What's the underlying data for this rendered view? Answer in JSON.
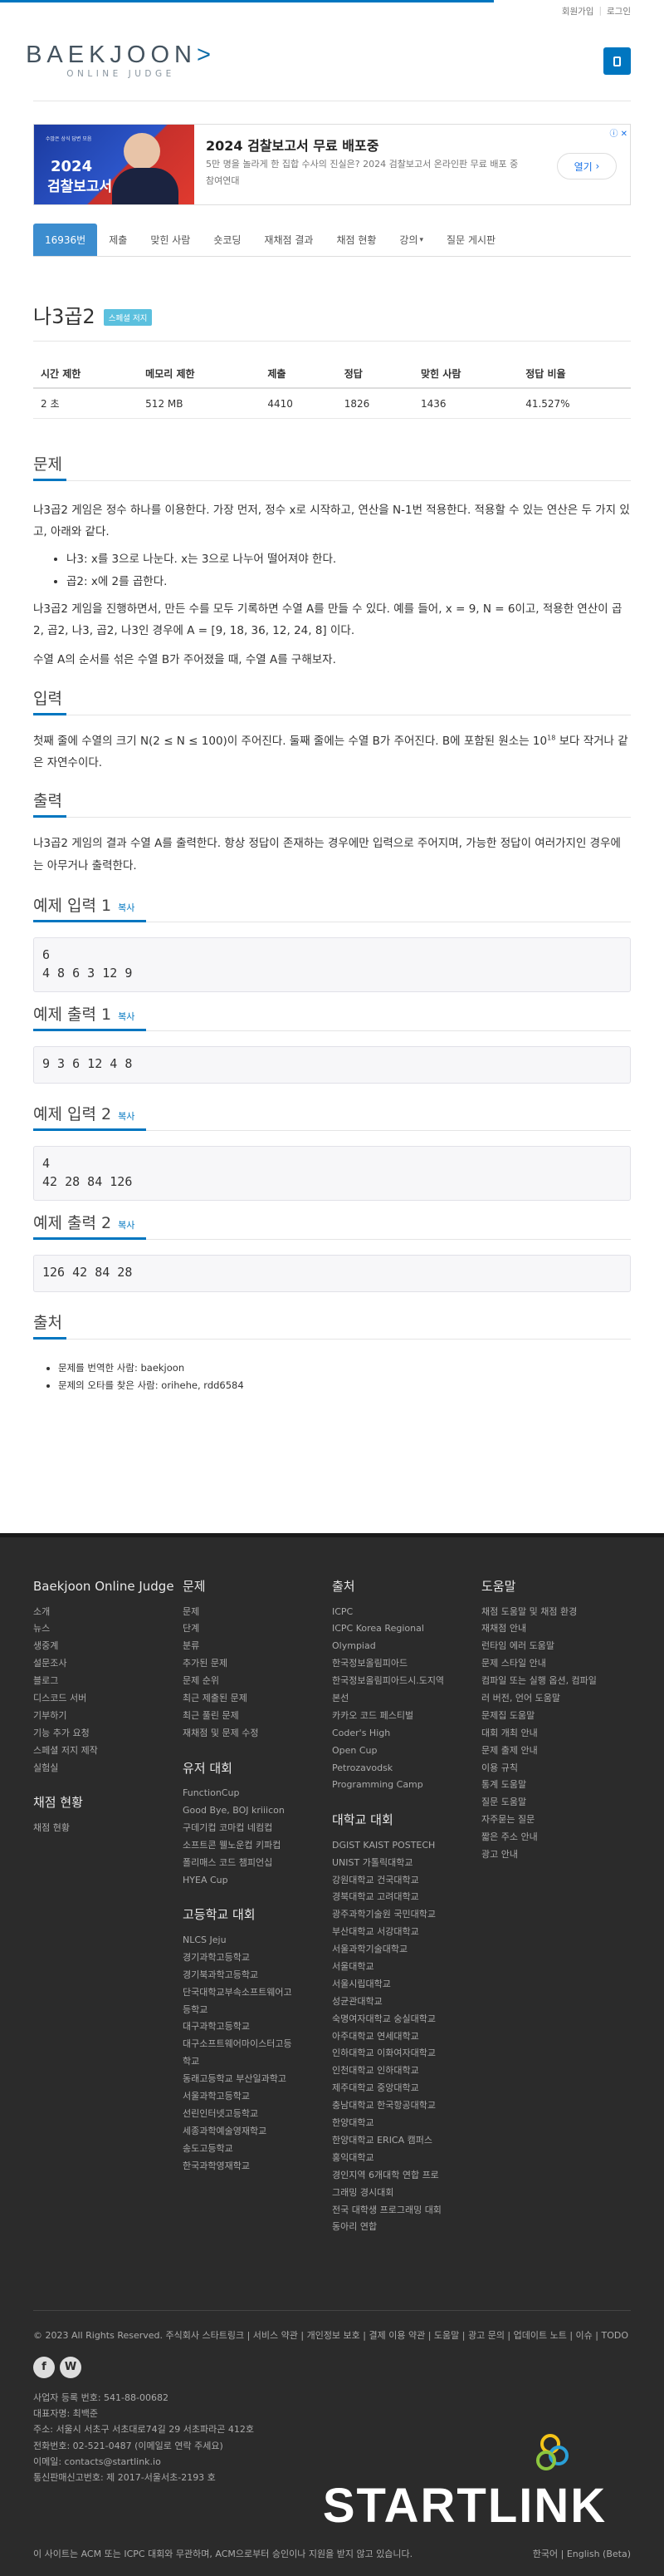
{
  "topbar": {
    "signup": "회원가입",
    "login": "로그인"
  },
  "logo": {
    "main_left": "BAEKJOON",
    "main_right": ">",
    "sub": "ONLINE JUDGE"
  },
  "ad": {
    "image_text_small": "수많은 상식 답변 모음",
    "image_text_year": "2024",
    "image_text_main": "검찰보고서",
    "title": "2024 검찰보고서 무료 배포중",
    "desc": "5만 명을 놀라게 한 집합 수사의 진실은? 2024 검찰보고서 온라인판 무료 배포 중",
    "source": "참여연대",
    "button": "열기",
    "close": "ⓘ ✕"
  },
  "tabs": [
    {
      "label": "16936번",
      "active": true
    },
    {
      "label": "제출"
    },
    {
      "label": "맞힌 사람"
    },
    {
      "label": "숏코딩"
    },
    {
      "label": "재채점 결과"
    },
    {
      "label": "채점 현황"
    },
    {
      "label": "강의",
      "dropdown": true
    },
    {
      "label": "질문 게시판"
    }
  ],
  "problem": {
    "title": "나3곱2",
    "badge": "스페셜 저지",
    "table_headers": [
      "시간 제한",
      "메모리 제한",
      "제출",
      "정답",
      "맞힌 사람",
      "정답 비율"
    ],
    "table_values": [
      "2 초",
      "512 MB",
      "4410",
      "1826",
      "1436",
      "41.527%"
    ]
  },
  "sections": {
    "problem_h": "문제",
    "problem_p1": "나3곱2 게임은 정수 하나를 이용한다. 가장 먼저, 정수 x로 시작하고, 연산을 N-1번 적용한다. 적용할 수 있는 연산은 두 가지 있고, 아래와 같다.",
    "bullet1": "나3: x를 3으로 나눈다. x는 3으로 나누어 떨어져야 한다.",
    "bullet2": "곱2: x에 2를 곱한다.",
    "problem_p2": "나3곱2 게임을 진행하면서, 만든 수를 모두 기록하면 수열 A를 만들 수 있다. 예를 들어, x = 9, N = 6이고, 적용한 연산이 곱2, 곱2, 나3, 곱2, 나3인 경우에 A = [9, 18, 36, 12, 24, 8] 이다.",
    "problem_p3": "수열 A의 순서를 섞은 수열 B가 주어졌을 때, 수열 A를 구해보자.",
    "input_h": "입력",
    "input_p_a": "첫째 줄에 수열의 크기 N(2 ≤ N ≤ 100)이 주어진다. 둘째 줄에는 수열 B가 주어진다. B에 포함된 원소는 10",
    "input_p_sup": "18",
    "input_p_b": " 보다 작거나 같은 자연수이다.",
    "output_h": "출력",
    "output_p": "나3곱2 게임의 결과 수열 A를 출력한다. 항상 정답이 존재하는 경우에만 입력으로 주어지며, 가능한 정답이 여러가지인 경우에는 아무거나 출력한다.",
    "copy": "복사",
    "sample_in1_h": "예제 입력 1",
    "sample_in1": "6\n4 8 6 3 12 9",
    "sample_out1_h": "예제 출력 1",
    "sample_out1": "9 3 6 12 4 8",
    "sample_in2_h": "예제 입력 2",
    "sample_in2": "4\n42 28 84 126",
    "sample_out2_h": "예제 출력 2",
    "sample_out2": "126 42 84 28",
    "source_h": "출처",
    "source_1": "문제를 번역한 사람: baekjoon",
    "source_2": "문제의 오타를 찾은 사람: orihehe, rdd6584"
  },
  "footer": {
    "col1_h": "Baekjoon Online Judge",
    "col1": [
      "소개",
      "뉴스",
      "생중계",
      "설문조사",
      "블로그",
      "디스코드 서버",
      "기부하기",
      "기능 추가 요청",
      "스페셜 저지 제작",
      "실험실"
    ],
    "col1b_h": "채점 현황",
    "col1b": [
      "채점 현황"
    ],
    "col2_h": "문제",
    "col2": [
      "문제",
      "단계",
      "분류",
      "추가된 문제",
      "문제 순위",
      "최근 제출된 문제",
      "최근 풀린 문제",
      "재채점 및 문제 수정"
    ],
    "col2b_h": "유저 대회",
    "col2b": [
      "FunctionCup",
      "Good Bye, BOJ kriiicon",
      "구데기컵 코마컵 네컴컵",
      "소프트콘 웰노운컵 키파컵",
      "폴리매스 코드 챔피언십",
      "HYEA Cup"
    ],
    "col2c_h": "고등학교 대회",
    "col2c": [
      "NLCS Jeju",
      "경기과학고등학교",
      "경기북과학고등학교",
      "단국대학교부속소프트웨어고",
      "등학교",
      "대구과학고등학교",
      "대구소프트웨어마이스터고등",
      "학교",
      "동래고등학교 부산일과학고",
      "서울과학고등학교",
      "선린인터넷고등학교",
      "세종과학예술영재학교",
      "송도고등학교",
      "한국과학영재학교"
    ],
    "col3_h": "출처",
    "col3": [
      "ICPC",
      "ICPC Korea Regional",
      "Olympiad",
      "한국정보올림피아드",
      "한국정보올림피아드시.도지역",
      "본선",
      "카카오 코드 페스티벌",
      "Coder's High",
      "Open Cup",
      "Petrozavodsk",
      "Programming Camp"
    ],
    "col3b_h": "대학교 대회",
    "col3b": [
      "DGIST KAIST POSTECH",
      "UNIST 가톨릭대학교",
      "강원대학교 건국대학교",
      "경북대학교 고려대학교",
      "광주과학기술원 국민대학교",
      "부산대학교 서강대학교",
      "서울과학기술대학교",
      "서울대학교",
      "서울시립대학교",
      "성균관대학교",
      "숙명여자대학교 숭실대학교",
      "아주대학교 연세대학교",
      "인하대학교 이화여자대학교",
      "인천대학교 인하대학교",
      "제주대학교 중앙대학교",
      "충남대학교 한국항공대학교",
      "한양대학교",
      "한양대학교 ERICA 캠퍼스",
      "홍익대학교",
      "경인지역 6개대학 연합 프로",
      "그래밍 경시대회",
      "전국 대학생 프로그래밍 대회",
      "동아리 연합"
    ],
    "col4_h": "도움말",
    "col4": [
      "채점 도움말 및 채점 환경",
      "재채점 안내",
      "런타임 에러 도움말",
      "문제 스타일 안내",
      "컴파일 또는 실행 옵션, 컴파일",
      "러 버전, 언어 도움말",
      "문제집 도움말",
      "대회 개최 안내",
      "문제 출제 안내",
      "이용 규칙",
      "통계 도움말",
      "질문 도움말",
      "자주묻는 질문",
      "짧은 주소 안내",
      "광고 안내"
    ],
    "bottom_links": "© 2023 All Rights Reserved. 주식회사 스타트링크 | 서비스 약관 | 개인정보 보호 | 결제 이용 약관 | 도움말 | 광고 문의 | 업데이트 노트 | 이슈 | TODO",
    "social_f": "f",
    "social_w": "W",
    "biz": [
      "사업자 등록 번호: 541-88-00682",
      "대표자명: 최백준",
      "주소: 서울시 서초구 서초대로74길 29 서초파라곤 412호",
      "전화번호: 02-521-0487 (이메일로 연락 주세요)",
      "이메일: contacts@startlink.io",
      "통신판매신고번호: 제 2017-서울서초-2193 호"
    ],
    "disclaimer": "이 사이트는 ACM 또는 ICPC 대회와 무관하며, ACM으로부터 승인이나 지원을 받지 않고 있습니다.",
    "lang": "한국어 | English (Beta)",
    "startlink": "STARTLINK"
  }
}
